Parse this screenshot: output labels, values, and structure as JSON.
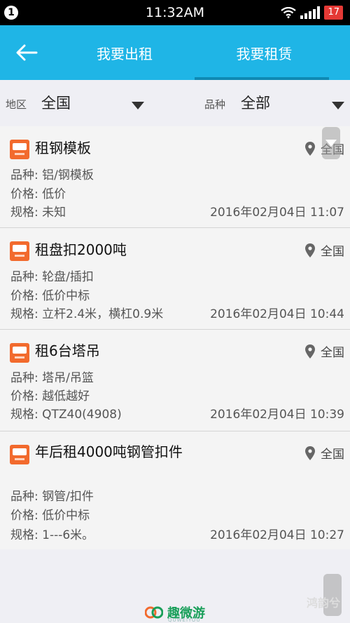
{
  "status": {
    "notification_count": "1",
    "time": "11:32AM",
    "battery": "17"
  },
  "header": {
    "tabs": [
      {
        "label": "我要出租"
      },
      {
        "label": "我要租赁"
      }
    ],
    "active_tab": 1
  },
  "filters": {
    "region": {
      "label": "地区",
      "value": "全国"
    },
    "category": {
      "label": "品种",
      "value": "全部"
    }
  },
  "listings": [
    {
      "title": "租钢模板",
      "location": "全国",
      "category": "品种: 铝/钢模板",
      "price": "价格: 低价",
      "spec": "规格: 未知",
      "date": "2016年02月04日 11:07"
    },
    {
      "title": "租盘扣2000吨",
      "location": "全国",
      "category": "品种: 轮盘/插扣",
      "price": "价格: 低价中标",
      "spec": "规格: 立杆2.4米，横杠0.9米",
      "date": "2016年02月04日 10:44"
    },
    {
      "title": "租6台塔吊",
      "location": "全国",
      "category": "品种: 塔吊/吊篮",
      "price": "价格: 越低越好",
      "spec": "规格: QTZ40(4908)",
      "date": "2016年02月04日 10:39"
    },
    {
      "title": "年后租4000吨钢管扣件",
      "location": "全国",
      "category": "品种: 钢管/扣件",
      "price": "价格: 低价中标",
      "spec": "规格: 1---6米。",
      "date": "2016年02月04日 10:27"
    }
  ],
  "watermark": {
    "text": "趣微游",
    "sub": "QUWEIYOU",
    "corner": "鸿韵兮"
  },
  "colors": {
    "appbar": "#1fb5e6",
    "accent_orange": "#f26a2d",
    "battery_red": "#e53935"
  }
}
